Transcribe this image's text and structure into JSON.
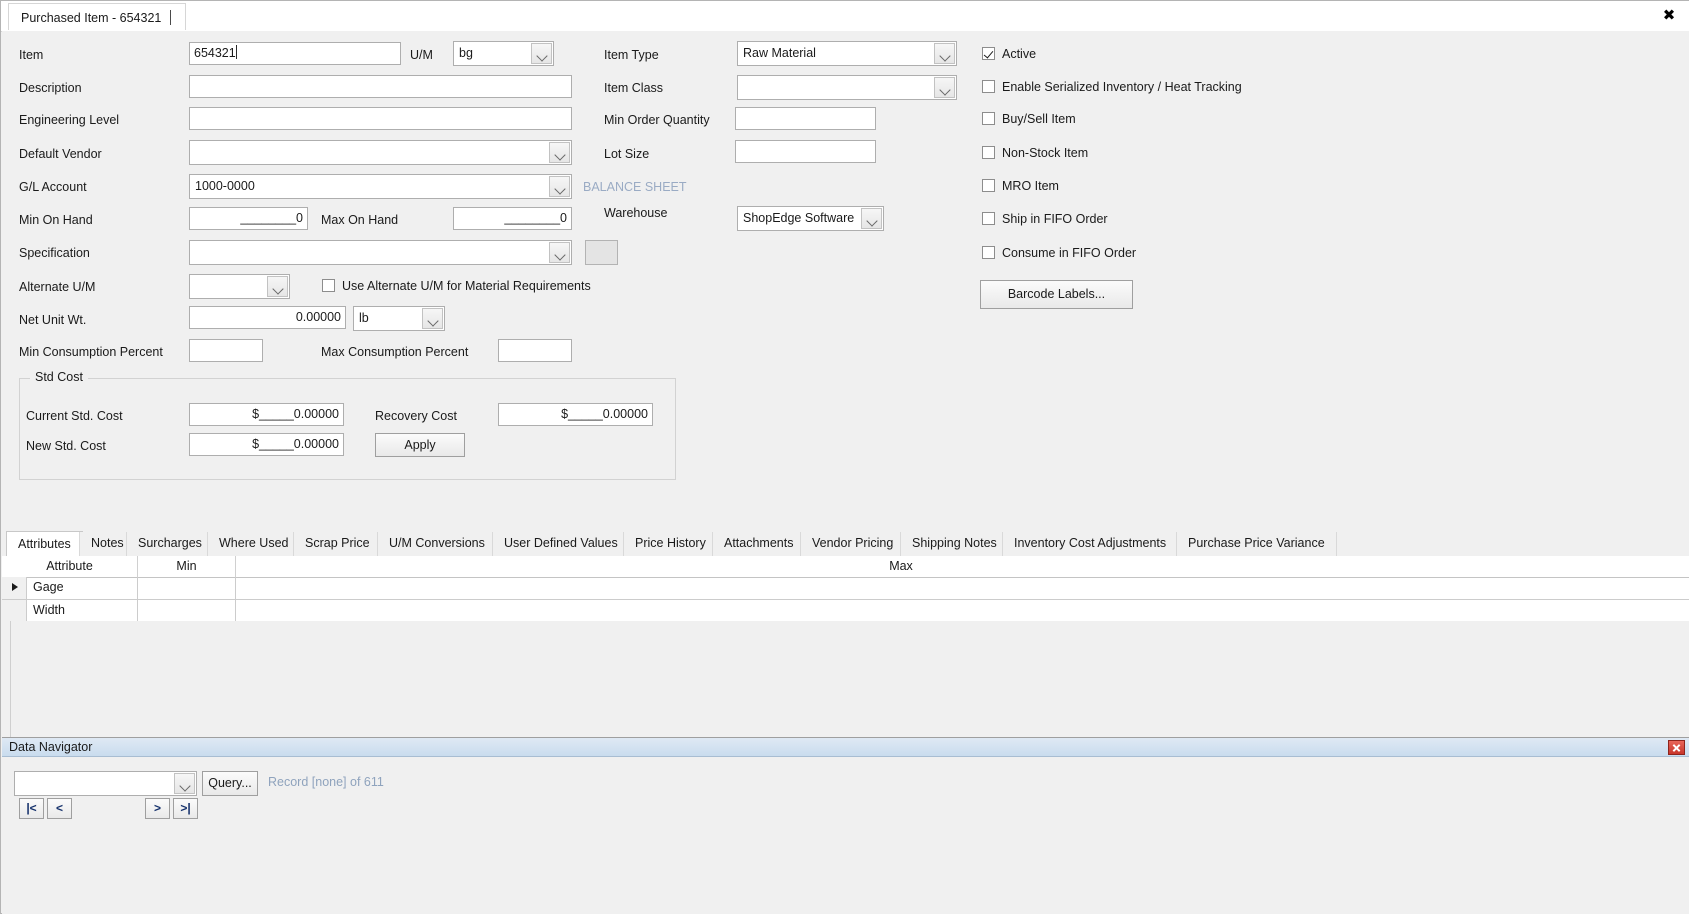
{
  "window": {
    "tab_title": "Purchased Item - 654321",
    "close_label": "✖"
  },
  "form": {
    "labels": {
      "item": "Item",
      "um": "U/M",
      "description": "Description",
      "engineering_level": "Engineering Level",
      "default_vendor": "Default Vendor",
      "gl_account": "G/L Account",
      "min_on_hand": "Min On Hand",
      "max_on_hand": "Max On Hand",
      "specification": "Specification",
      "alternate_um": "Alternate U/M",
      "net_unit_wt": "Net Unit Wt.",
      "min_consumption_percent": "Min Consumption Percent",
      "max_consumption_percent": "Max Consumption Percent",
      "item_type": "Item Type",
      "item_class": "Item Class",
      "min_order_quantity": "Min Order Quantity",
      "lot_size": "Lot Size",
      "balance_sheet": "BALANCE SHEET",
      "warehouse": "Warehouse"
    },
    "values": {
      "item": "654321",
      "um": "bg",
      "description": "",
      "engineering_level": "",
      "default_vendor": "",
      "gl_account": "1000-0000",
      "min_on_hand": "________0",
      "max_on_hand": "________0",
      "specification": "",
      "alternate_um": "",
      "net_unit_wt": "0.00000",
      "net_unit_wt_uom": "lb",
      "min_consumption_percent": "",
      "max_consumption_percent": "",
      "item_type": "Raw Material",
      "item_class": "",
      "min_order_quantity": "",
      "lot_size": "",
      "warehouse": "ShopEdge Software"
    },
    "use_alternate_um_label": "Use Alternate U/M for Material Requirements",
    "use_alternate_um_checked": false
  },
  "checkboxes": [
    {
      "label": "Active",
      "checked": true
    },
    {
      "label": "Enable Serialized Inventory / Heat Tracking",
      "checked": false
    },
    {
      "label": "Buy/Sell Item",
      "checked": false
    },
    {
      "label": "Non-Stock Item",
      "checked": false
    },
    {
      "label": "MRO Item",
      "checked": false
    },
    {
      "label": "Ship in FIFO Order",
      "checked": false
    },
    {
      "label": "Consume in FIFO Order",
      "checked": false
    }
  ],
  "barcode_button": "Barcode Labels...",
  "std_cost": {
    "title": "Std Cost",
    "current_label": "Current Std. Cost",
    "current_value": "$_____0.00000",
    "new_label": "New Std. Cost",
    "new_value": "$_____0.00000",
    "recovery_label": "Recovery Cost",
    "recovery_value": "$_____0.00000",
    "apply_label": "Apply"
  },
  "tabs": [
    {
      "label": "Attributes",
      "selected": true
    },
    {
      "label": "Notes",
      "selected": false
    },
    {
      "label": "Surcharges",
      "selected": false
    },
    {
      "label": "Where Used",
      "selected": false
    },
    {
      "label": "Scrap Price",
      "selected": false
    },
    {
      "label": "U/M Conversions",
      "selected": false
    },
    {
      "label": "User Defined Values",
      "selected": false
    },
    {
      "label": "Price History",
      "selected": false
    },
    {
      "label": "Attachments",
      "selected": false
    },
    {
      "label": "Vendor Pricing",
      "selected": false
    },
    {
      "label": "Shipping Notes",
      "selected": false
    },
    {
      "label": "Inventory Cost Adjustments",
      "selected": false
    },
    {
      "label": "Purchase Price Variance",
      "selected": false
    }
  ],
  "grid": {
    "columns": [
      "Attribute",
      "Min",
      "Max"
    ],
    "rows": [
      {
        "selected": true,
        "attribute": "Gage",
        "min": "",
        "max": ""
      },
      {
        "selected": false,
        "attribute": "Width",
        "min": "",
        "max": ""
      }
    ]
  },
  "data_navigator": {
    "title": "Data Navigator",
    "query_button": "Query...",
    "record_info": "Record [none] of 611",
    "query_value": "",
    "nav_first": "|<",
    "nav_prev": "<",
    "nav_next": ">",
    "nav_last": ">|"
  },
  "colors": {
    "window_bg": "#f0f0f0",
    "accent_blue_header": "#c9dcee",
    "muted_text": "#8fa3bd",
    "close_red": "#c8352a"
  }
}
